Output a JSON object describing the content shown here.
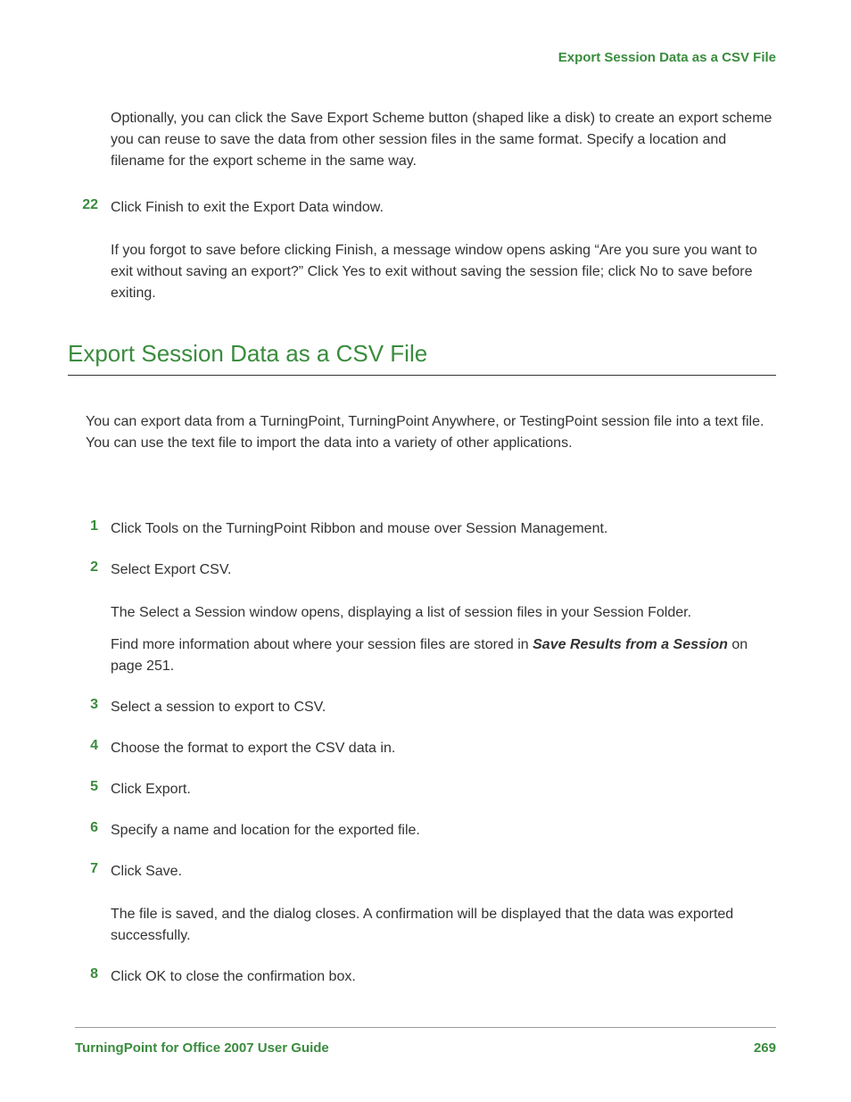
{
  "header": {
    "title": "Export Session Data as a CSV File"
  },
  "intro": {
    "paragraph1": "Optionally, you can click the Save Export Scheme button (shaped like a disk) to create an export scheme you can reuse to save the data from other session files in the same format. Specify a location and filename for the export scheme in the same way."
  },
  "step22": {
    "number": "22",
    "text": "Click Finish to exit the Export Data window.",
    "sub": "If you forgot to save before clicking Finish, a message window opens asking “Are you sure you want to exit without saving an export?” Click Yes to exit without saving the session file; click No to save before exiting."
  },
  "section": {
    "heading": "Export Session Data as a CSV File",
    "intro": "You can export data from a TurningPoint, TurningPoint Anywhere, or TestingPoint session file into a text file. You can use the text file to import the data into a variety of other applications."
  },
  "steps": [
    {
      "number": "1",
      "text": "Click Tools on the TurningPoint Ribbon and mouse over Session Management."
    },
    {
      "number": "2",
      "text": "Select Export CSV.",
      "sub1": "The Select a Session window opens, displaying a list of session files in your Session Folder.",
      "sub2_prefix": "Find more information about where your session files are stored in ",
      "sub2_link": "Save Results from a Session",
      "sub2_suffix": " on page 251."
    },
    {
      "number": "3",
      "text": "Select a session to export to CSV."
    },
    {
      "number": "4",
      "text": "Choose the format to export the CSV data in."
    },
    {
      "number": "5",
      "text": "Click Export."
    },
    {
      "number": "6",
      "text": "Specify a name and location for the exported file."
    },
    {
      "number": "7",
      "text": "Click Save.",
      "sub1": "The file is saved, and the dialog closes. A confirmation will be displayed that the data was exported successfully."
    },
    {
      "number": "8",
      "text": "Click OK to close the confirmation box."
    }
  ],
  "footer": {
    "left": "TurningPoint for Office 2007 User Guide",
    "right": "269"
  }
}
